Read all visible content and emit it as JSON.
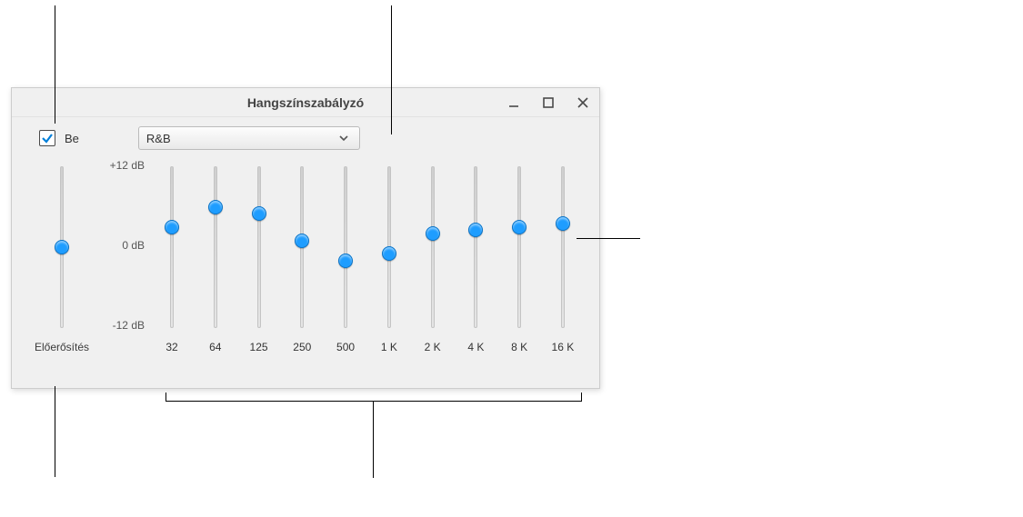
{
  "window": {
    "title": "Hangszínszabályzó"
  },
  "controls": {
    "enable_label": "Be",
    "preset_selected": "R&B"
  },
  "scale": {
    "top": "+12 dB",
    "mid": "0 dB",
    "bottom": "-12 dB"
  },
  "preamp": {
    "label": "Előerősítés",
    "value_db": 0
  },
  "bands": [
    {
      "freq": "32",
      "value_db": 3.0
    },
    {
      "freq": "64",
      "value_db": 6.0
    },
    {
      "freq": "125",
      "value_db": 5.0
    },
    {
      "freq": "250",
      "value_db": 1.0
    },
    {
      "freq": "500",
      "value_db": -2.0
    },
    {
      "freq": "1 K",
      "value_db": -1.0
    },
    {
      "freq": "2 K",
      "value_db": 2.0
    },
    {
      "freq": "4 K",
      "value_db": 2.5
    },
    {
      "freq": "8 K",
      "value_db": 3.0
    },
    {
      "freq": "16 K",
      "value_db": 3.5
    }
  ]
}
